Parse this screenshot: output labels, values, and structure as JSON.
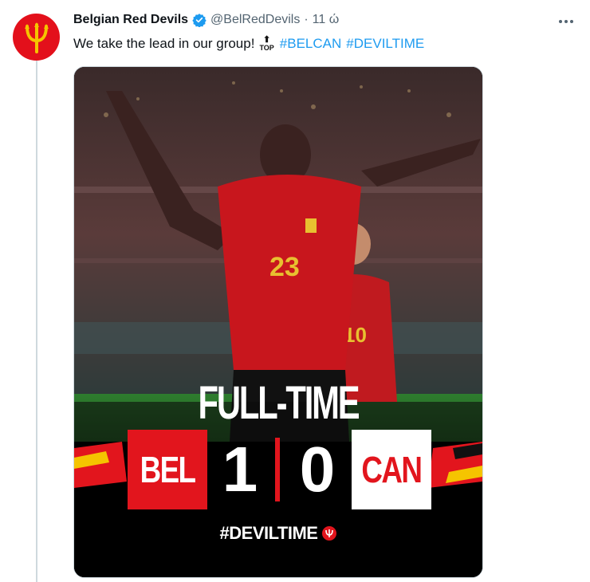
{
  "tweet": {
    "author_name": "Belgian Red Devils",
    "handle": "@BelRedDevils",
    "separator": "·",
    "time": "11 ώ",
    "text": "We take the lead in our group!",
    "emoji_text": "TOP",
    "hashtags": [
      "#BELCAN",
      "#DEVILTIME"
    ]
  },
  "media": {
    "headline": "FULL-TIME",
    "team_home": "BEL",
    "score_home": "1",
    "score_away": "0",
    "team_away": "CAN",
    "footer_tag": "#DEVILTIME"
  },
  "colors": {
    "brand_red": "#e2151d",
    "link_blue": "#1d9bf0",
    "verified_blue": "#1d9bf0",
    "text_secondary": "#536471"
  },
  "icons": {
    "avatar": "trident-icon",
    "verified": "verified-badge-icon",
    "more": "more-dots-icon"
  }
}
